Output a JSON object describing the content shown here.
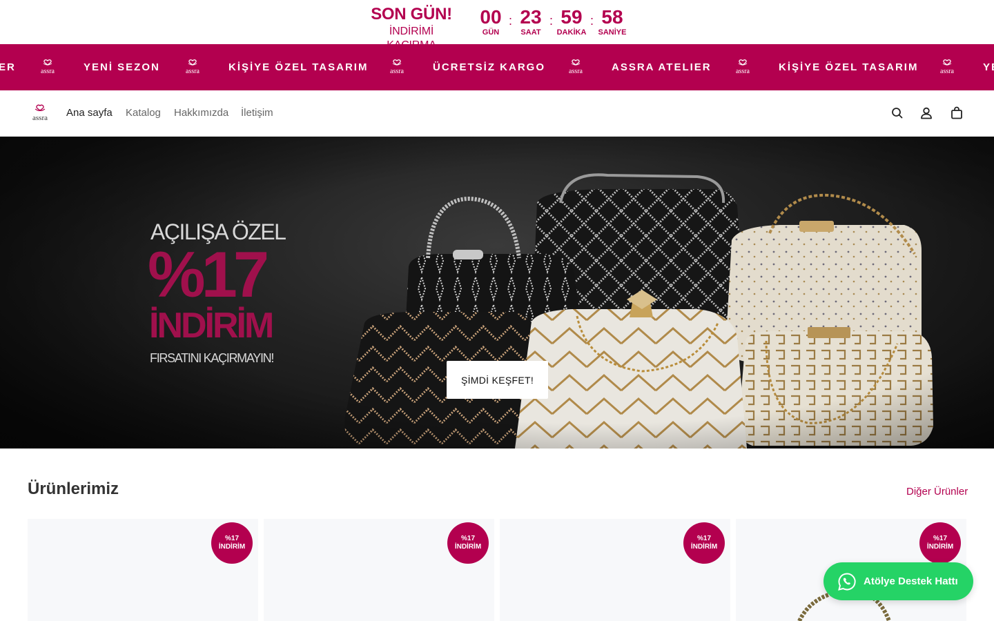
{
  "countdown": {
    "title": "SON GÜN!",
    "subtitle": "İNDİRİMİ KAÇIRMA",
    "units": [
      {
        "value": "00",
        "label": "GÜN"
      },
      {
        "value": "23",
        "label": "SAAT"
      },
      {
        "value": "59",
        "label": "DAKİKA"
      },
      {
        "value": "58",
        "label": "SANİYE"
      }
    ],
    "separator": ":"
  },
  "marquee": {
    "items": [
      "ER",
      "YENİ SEZON",
      "KİŞİYE ÖZEL TASARIM",
      "ÜCRETSİZ KARGO",
      "ASSRA ATELIER",
      "KİŞİYE ÖZEL TASARIM",
      "YE"
    ],
    "logo_icon": "assra-logo-icon"
  },
  "header": {
    "logo_text": "assra",
    "nav": [
      "Ana sayfa",
      "Katalog",
      "Hakkımızda",
      "İletişim"
    ],
    "icons": [
      "search-icon",
      "account-icon",
      "cart-icon"
    ]
  },
  "hero": {
    "line1": "AÇILIŞA ÖZEL",
    "big": "%17",
    "discount": "İNDİRİM",
    "tagline": "FIRSATINI KAÇIRMAYIN!",
    "cta": "ŞİMDİ KEŞFET!"
  },
  "products": {
    "title": "Ürünlerimiz",
    "more_link": "Diğer Ürünler",
    "cards": [
      {
        "badge_line1": "%17",
        "badge_line2": "İNDİRİM"
      },
      {
        "badge_line1": "%17",
        "badge_line2": "İNDİRİM"
      },
      {
        "badge_line1": "%17",
        "badge_line2": "İNDİRİM"
      },
      {
        "badge_line1": "%17",
        "badge_line2": "İNDİRİM"
      }
    ]
  },
  "whatsapp": {
    "label": "Atölye Destek Hattı",
    "icon": "whatsapp-icon"
  },
  "colors": {
    "brand": "#b3004f",
    "whatsapp": "#25d366",
    "hero_bg": "#1a1a1a"
  }
}
